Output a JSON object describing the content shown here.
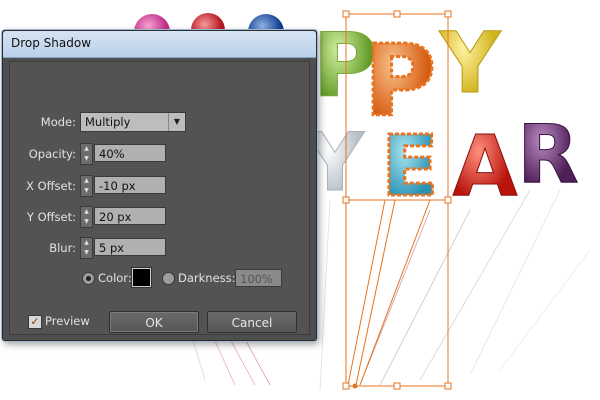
{
  "dialog": {
    "title": "Drop Shadow",
    "mode": {
      "label": "Mode:",
      "value": "Multiply"
    },
    "opacity": {
      "label": "Opacity:",
      "value": "40%"
    },
    "x_offset": {
      "label": "X Offset:",
      "value": "-10 px"
    },
    "y_offset": {
      "label": "Y Offset:",
      "value": "20 px"
    },
    "blur": {
      "label": "Blur:",
      "value": "5 px"
    },
    "color_option": {
      "label": "Color:",
      "selected": true,
      "swatch": "#000000"
    },
    "darkness_option": {
      "label": "Darkness:",
      "value": "100%",
      "selected": false
    },
    "preview": {
      "label": "Preview",
      "checked": true
    },
    "ok_label": "OK",
    "cancel_label": "Cancel"
  },
  "canvas": {
    "balloon_letters": [
      "P",
      "P",
      "Y",
      "Y",
      "E",
      "A",
      "R"
    ],
    "accent_colors": {
      "selection": "#e8731f",
      "dialog_bg": "#535353"
    }
  }
}
